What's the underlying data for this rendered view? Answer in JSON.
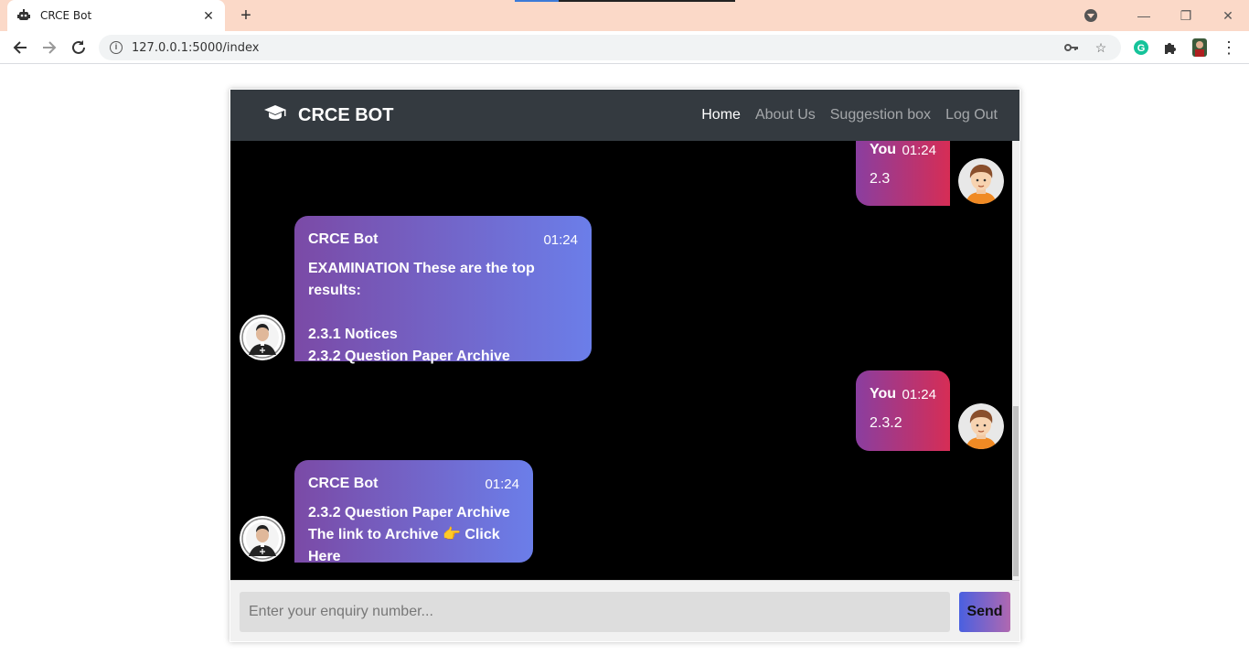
{
  "browser": {
    "tab_title": "CRCE Bot",
    "new_tab_symbol": "+",
    "url": "127.0.0.1:5000/index"
  },
  "app": {
    "brand": "CRCE BOT",
    "nav": [
      "Home",
      "About Us",
      "Suggestion box",
      "Log Out"
    ]
  },
  "messages": {
    "m1": {
      "sender": "You",
      "time": "01:24",
      "text": "2.3"
    },
    "m2": {
      "sender": "CRCE Bot",
      "time": "01:24",
      "line1": "EXAMINATION These are the top results:",
      "line2": "2.3.1 Notices",
      "line3": "2.3.2 Question Paper Archive"
    },
    "m3": {
      "sender": "You",
      "time": "01:24",
      "text": "2.3.2"
    },
    "m4": {
      "sender": "CRCE Bot",
      "time": "01:24",
      "line1": "2.3.2 Question Paper Archive",
      "line2_pre": "The link to Archive ",
      "line2_emoji": "👉",
      "line2_link": " Click Here"
    }
  },
  "input": {
    "placeholder": "Enter your enquiry number...",
    "send_label": "Send"
  },
  "colors": {
    "navbar": "#343a40",
    "bot_bubble_start": "#7b4aa6",
    "bot_bubble_end": "#6b7ee9",
    "user_bubble_start": "#8a3ea0",
    "user_bubble_end": "#d62d55"
  }
}
